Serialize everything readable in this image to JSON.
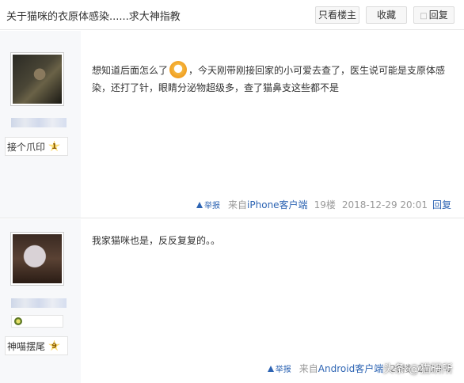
{
  "thread": {
    "title": "关于猫咪的衣原体感染......求大神指教",
    "buttons": {
      "only_op": "只看楼主",
      "favorite": "收藏",
      "reply": "回复"
    }
  },
  "posts": [
    {
      "level_name": "接个爪印",
      "level_num": "1",
      "content_before": "想知道后面怎么了",
      "emoji": "emoji-icon",
      "content_after": "，今天刚带刚接回家的小可爱去查了，医生说可能是支原体感染，还打了针，眼睛分泌物超级多，查了猫鼻支这些都不是",
      "report": "举报",
      "source_prefix": "来自",
      "source_link": "iPhone客户端",
      "floor": "19楼",
      "time": "2018-12-29 20:01",
      "reply": "回复"
    },
    {
      "level_name": "神喵摆尾",
      "level_num": "9",
      "content": "我家猫咪也是，反反复复的。。",
      "report": "举报",
      "source_prefix": "来自",
      "source_link": "Android客户端",
      "floor": "20楼",
      "time": "2019-0",
      "reply": ""
    }
  ],
  "watermark": "头条 @猫研所",
  "colors": {
    "link": "#2d64b3",
    "meta": "#999999",
    "sidebar": "#f7f8fa"
  }
}
